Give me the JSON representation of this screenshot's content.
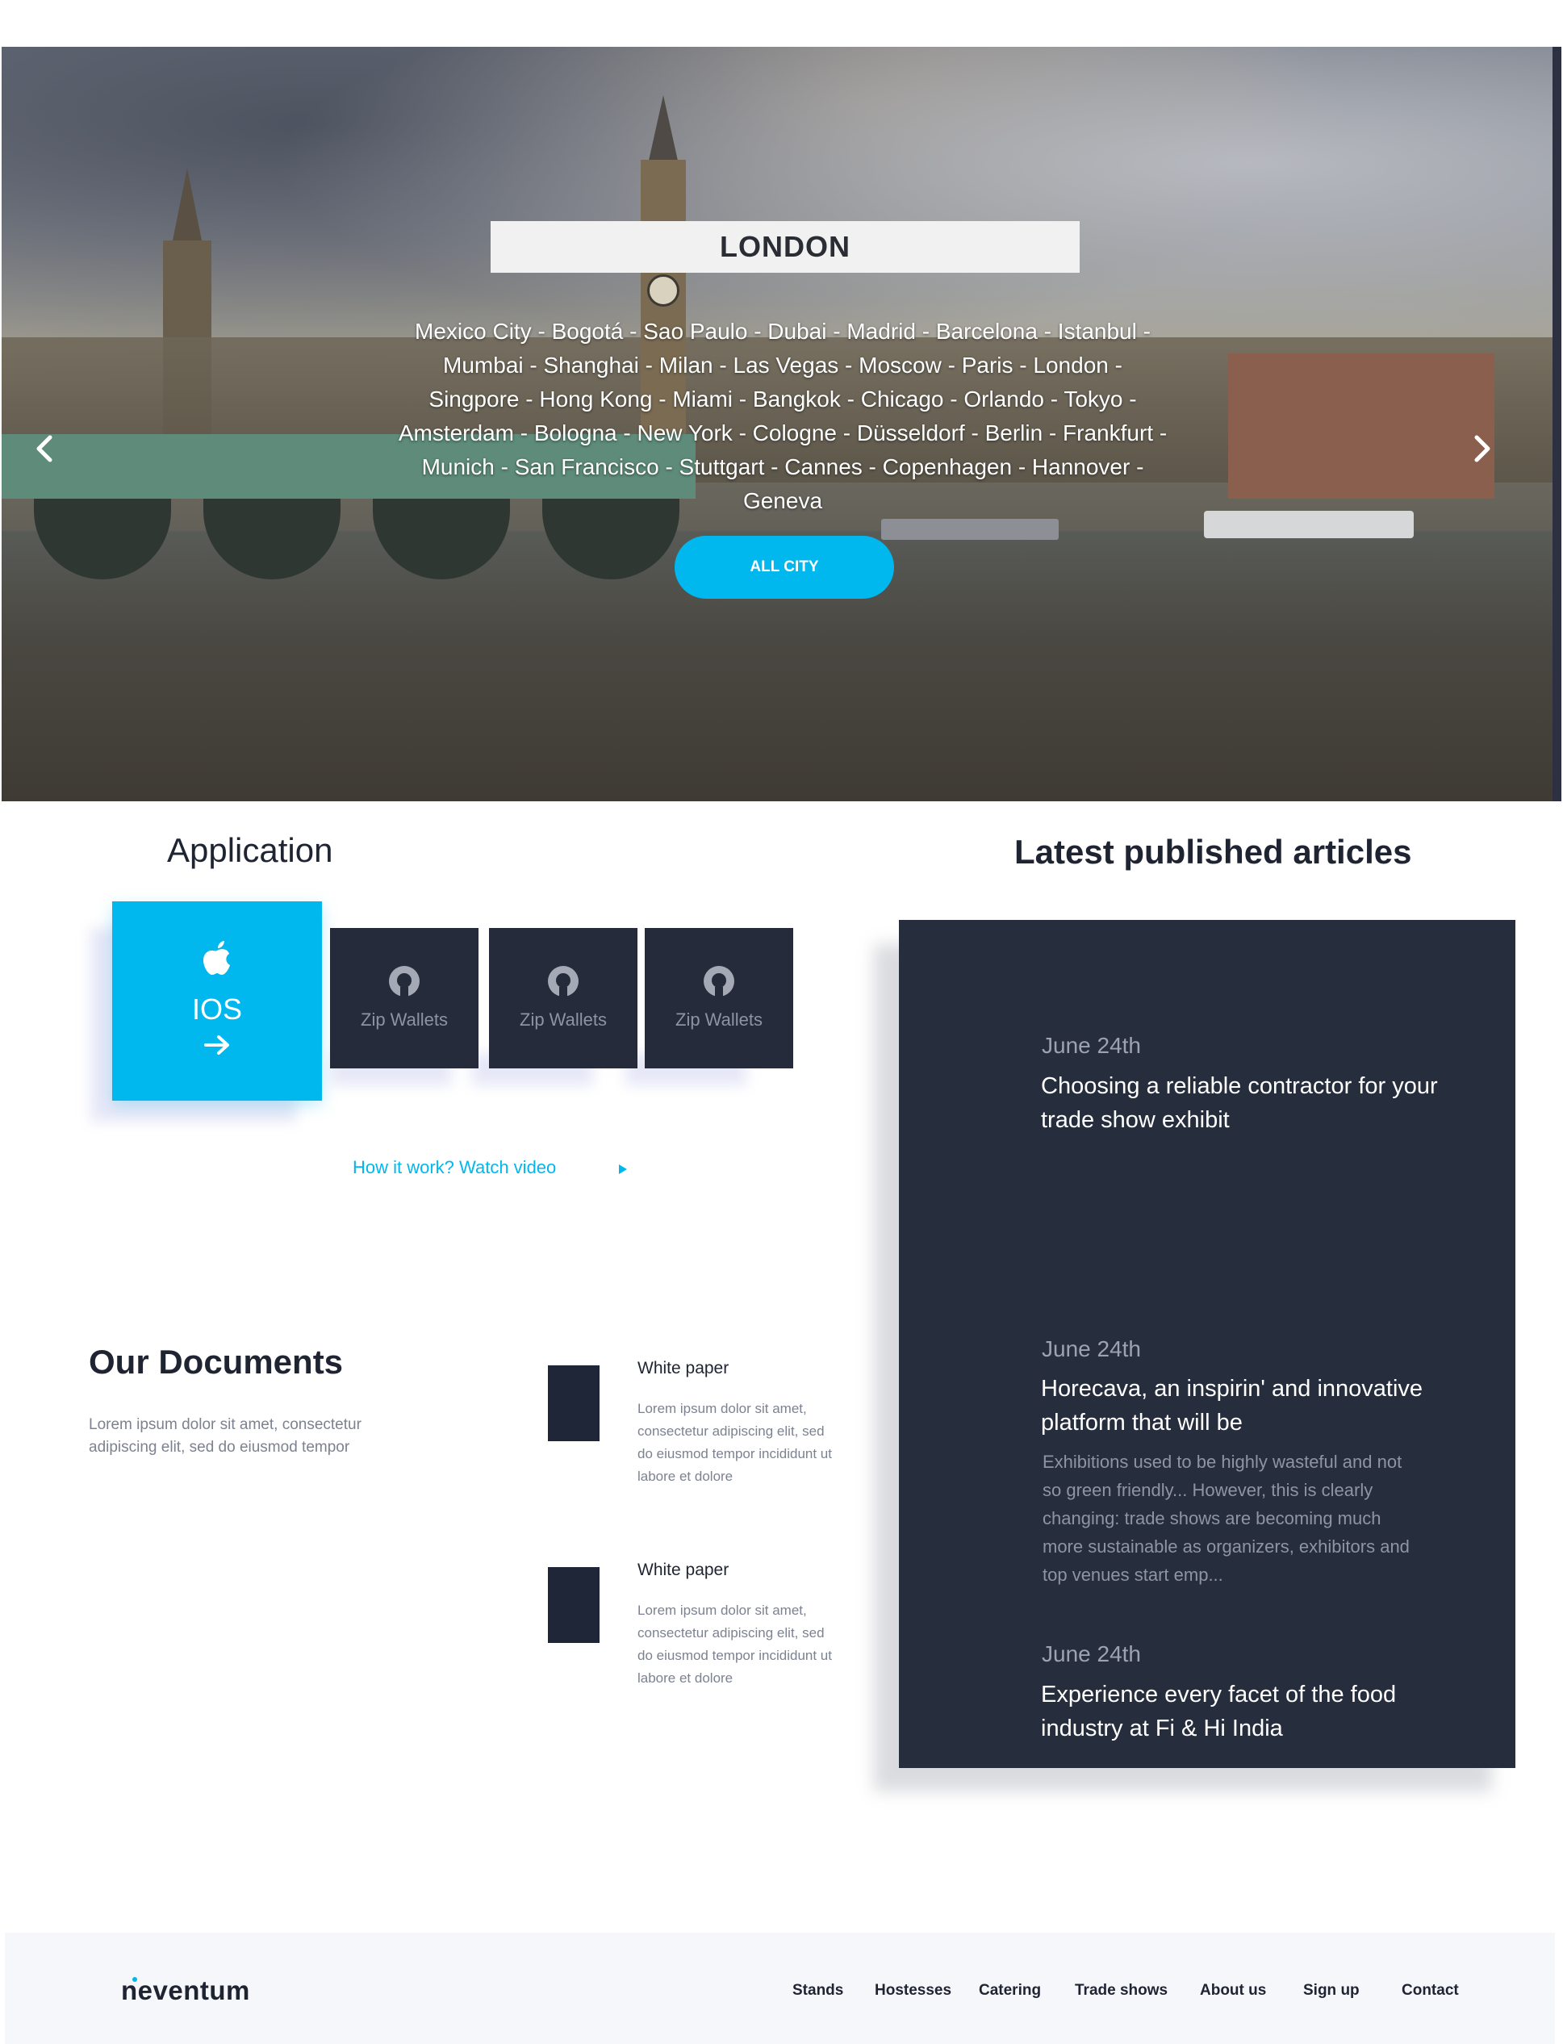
{
  "hero": {
    "title": "LONDON",
    "cities": "Mexico City - Bogotá - Sao Paulo - Dubai - Madrid - Barcelona - Istanbul - Mumbai - Shanghai - Milan - Las Vegas - Moscow - Paris - London - Singpore - Hong Kong - Miami - Bangkok - Chicago - Orlando - Tokyo - Amsterdam - Bologna - New York - Cologne - Düsseldorf - Berlin - Frankfurt - Munich - San Francisco - Stuttgart - Cannes - Copenhagen - Hannover - Geneva",
    "button_label": "ALL CITY",
    "prev_icon": "chevron-left-icon",
    "next_icon": "chevron-right-icon"
  },
  "application": {
    "heading": "Application",
    "ios_label": "IOS",
    "wallets": [
      "Zip Wallets",
      "Zip Wallets",
      "Zip Wallets"
    ],
    "watch_link": "How it work? Watch video"
  },
  "articles": {
    "heading": "Latest published articles",
    "items": [
      {
        "date": "June 24th",
        "title": "Choosing a reliable contractor for your trade show exhibit",
        "excerpt": ""
      },
      {
        "date": "June 24th",
        "title": "Horecava, an inspirin' and innovative platform that will be",
        "excerpt": "Exhibitions used to be highly wasteful and not so green friendly... However, this is clearly changing: trade shows are becoming much more sustainable as organizers, exhibitors and top venues start emp..."
      },
      {
        "date": "June 24th",
        "title": "Experience every facet of the food industry at Fi & Hi India",
        "excerpt": ""
      }
    ]
  },
  "documents": {
    "heading": "Our Documents",
    "description": "Lorem ipsum dolor sit amet, consectetur adipiscing elit, sed do eiusmod tempor",
    "items": [
      {
        "title": "White paper",
        "text": "Lorem ipsum dolor sit amet, consectetur adipiscing elit, sed do eiusmod tempor incididunt ut labore et dolore"
      },
      {
        "title": "White paper",
        "text": "Lorem ipsum dolor sit amet, consectetur adipiscing elit, sed do eiusmod tempor incididunt ut labore et dolore"
      }
    ]
  },
  "footer": {
    "logo": "neventum",
    "nav": [
      "Stands",
      "Hostesses",
      "Catering",
      "Trade shows",
      "About us",
      "Sign up",
      "Contact"
    ]
  },
  "colors": {
    "accent": "#00b7ee",
    "dark_panel": "#262d3d",
    "tile": "#252b3a"
  }
}
